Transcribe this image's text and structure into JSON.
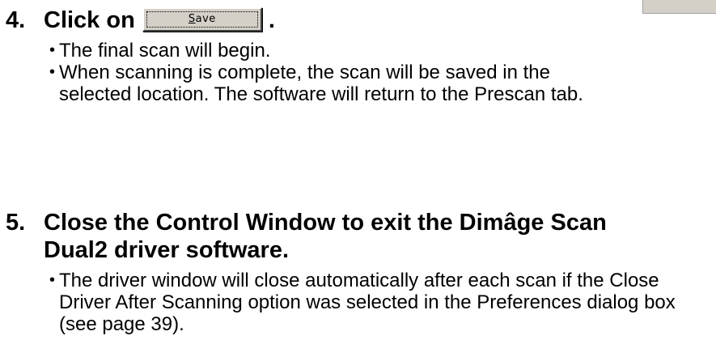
{
  "steps": [
    {
      "number": "4.",
      "heading_prefix": "Click on",
      "heading_suffix": ".",
      "button": {
        "mnemonic": "S",
        "rest": "ave"
      },
      "bullets": [
        "The final scan will begin.",
        "When scanning is complete, the scan will be saved in the selected location. The software will return to the Prescan tab."
      ]
    },
    {
      "number": "5.",
      "heading_line1": "Close the Control Window to exit the Dimâge Scan",
      "heading_line2": "Dual2 driver software.",
      "bullets": [
        "The driver window will close automatically after each scan if the Close Driver After Scanning option was selected in the Preferences dialog box (see page 39)."
      ]
    }
  ],
  "bullet_glyph": "•"
}
